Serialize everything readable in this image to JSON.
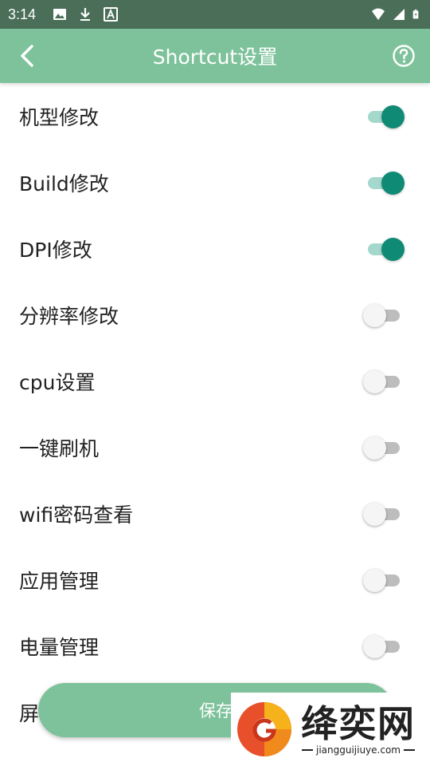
{
  "status_bar": {
    "time": "3:14",
    "left_icons": [
      "image-icon",
      "download-icon",
      "font-icon"
    ],
    "right_icons": [
      "wifi-icon",
      "signal-icon",
      "battery-icon"
    ]
  },
  "app_bar": {
    "title": "Shortcut设置",
    "color": "#7dc29a"
  },
  "settings": [
    {
      "label": "机型修改",
      "enabled": true
    },
    {
      "label": "Build修改",
      "enabled": true
    },
    {
      "label": "DPI修改",
      "enabled": true
    },
    {
      "label": "分辨率修改",
      "enabled": false
    },
    {
      "label": "cpu设置",
      "enabled": false
    },
    {
      "label": "一键刷机",
      "enabled": false
    },
    {
      "label": "wifi密码查看",
      "enabled": false
    },
    {
      "label": "应用管理",
      "enabled": false
    },
    {
      "label": "电量管理",
      "enabled": false
    },
    {
      "label": "屏",
      "enabled": false
    }
  ],
  "save_button": {
    "label": "保存"
  },
  "watermark": {
    "brand": "绛奕网",
    "url": "jiangguijiuye.com"
  },
  "colors": {
    "accent": "#0f8a74",
    "primary": "#7dc29a",
    "status_bar": "#4a6e58"
  }
}
